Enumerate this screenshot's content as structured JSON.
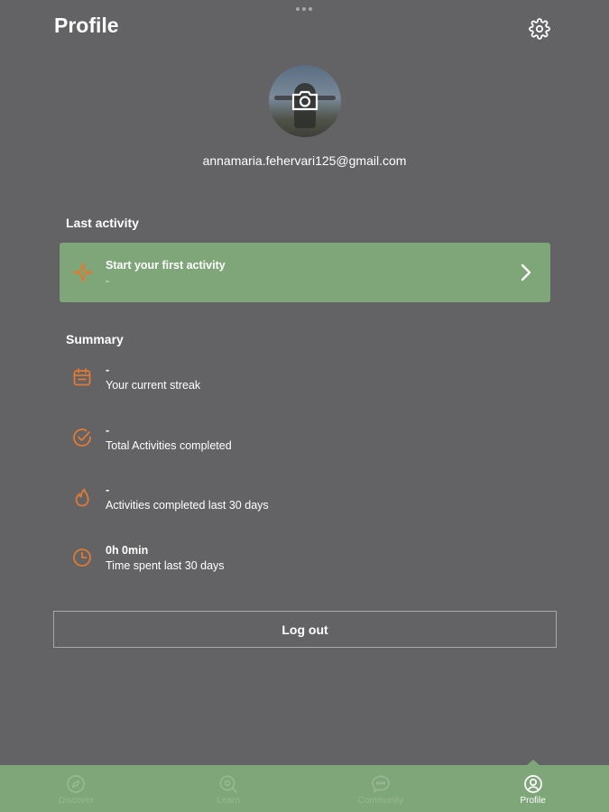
{
  "header": {
    "title": "Profile",
    "settings_icon": "gear-icon"
  },
  "profile": {
    "avatar_icon": "camera-icon",
    "email": "annamaria.fehervari125@gmail.com"
  },
  "last_activity": {
    "section_title": "Last activity",
    "card_title": "Start your first activity",
    "card_subtitle": "-",
    "icon": "sparkle-icon",
    "chevron_icon": "chevron-right-icon",
    "card_color": "#7ea678"
  },
  "summary": {
    "section_title": "Summary",
    "accent_color": "#e07a34",
    "items": [
      {
        "value": "-",
        "label": "Your current streak",
        "icon": "calendar-icon"
      },
      {
        "value": "-",
        "label": "Total Activities completed",
        "icon": "check-circle-icon"
      },
      {
        "value": "-",
        "label": "Activities completed last 30 days",
        "icon": "flame-icon"
      },
      {
        "value": "0h 0min",
        "label": "Time spent last 30 days",
        "icon": "clock-icon"
      }
    ]
  },
  "logout": {
    "label": "Log out"
  },
  "tabbar": {
    "active": "Profile",
    "tabs": [
      {
        "label": "Discover",
        "icon": "compass-icon"
      },
      {
        "label": "Learn",
        "icon": "search-learn-icon"
      },
      {
        "label": "Community",
        "icon": "chat-bubble-icon"
      },
      {
        "label": "Profile",
        "icon": "user-circle-icon"
      }
    ]
  }
}
